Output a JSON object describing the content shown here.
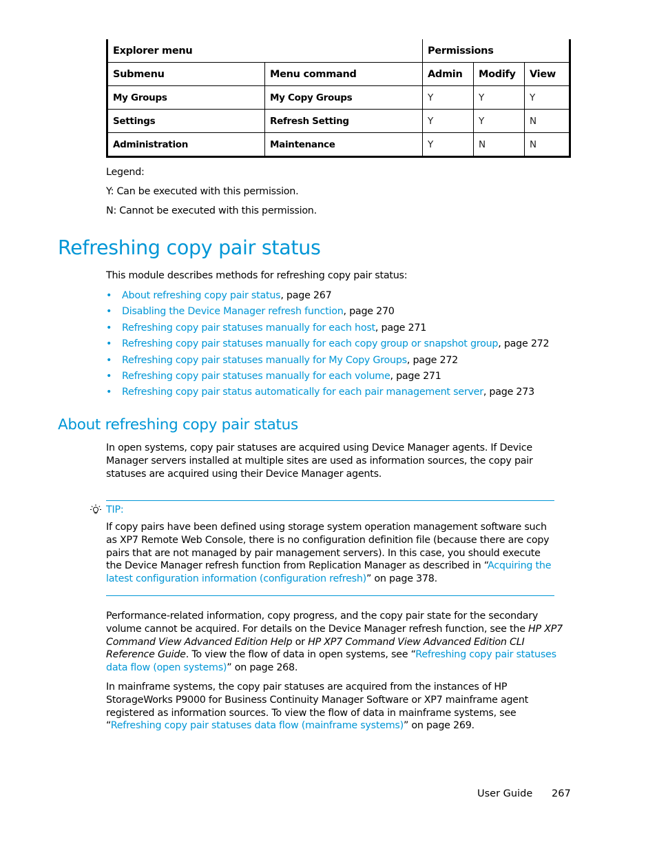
{
  "table": {
    "group_header": {
      "explorer_menu": "Explorer menu",
      "permissions": "Permissions"
    },
    "columns": [
      "Submenu",
      "Menu command",
      "Admin",
      "Modify",
      "View"
    ],
    "rows": [
      {
        "submenu": "My Groups",
        "command": "My Copy Groups",
        "admin": "Y",
        "modify": "Y",
        "view": "Y"
      },
      {
        "submenu": "Settings",
        "command": "Refresh Setting",
        "admin": "Y",
        "modify": "Y",
        "view": "N"
      },
      {
        "submenu": "Administration",
        "command": "Maintenance",
        "admin": "Y",
        "modify": "N",
        "view": "N"
      }
    ]
  },
  "legend": {
    "title": "Legend:",
    "y": "Y: Can be executed with this permission.",
    "n": "N: Cannot be executed with this permission."
  },
  "section": {
    "title": "Refreshing copy pair status",
    "intro": "This module describes methods for refreshing copy pair status:",
    "toc": [
      {
        "link": "About refreshing copy pair status",
        "page": ", page 267"
      },
      {
        "link": "Disabling the Device Manager refresh function",
        "page": ", page 270"
      },
      {
        "link": "Refreshing copy pair statuses manually for each host",
        "page": ", page 271"
      },
      {
        "link": "Refreshing copy pair statuses manually for each copy group or snapshot group",
        "page": ", page 272"
      },
      {
        "link": "Refreshing copy pair statuses manually for My Copy Groups",
        "page": ", page 272"
      },
      {
        "link": "Refreshing copy pair statuses manually for each volume",
        "page": ", page 271"
      },
      {
        "link": "Refreshing copy pair status automatically for each pair management server",
        "page": ", page 273"
      }
    ]
  },
  "subsection": {
    "title": "About refreshing copy pair status",
    "para1": "In open systems, copy pair statuses are acquired using Device Manager agents. If Device Manager servers installed at multiple sites are used as information sources, the copy pair statuses are acquired using their Device Manager agents.",
    "tip": {
      "label": "TIP:",
      "text_before": "If copy pairs have been defined using storage system operation management software such as XP7 Remote Web Console, there is no configuration definition file (because there are copy pairs that are not managed by pair management servers). In this case, you should execute the Device Manager refresh function from Replication Manager as described in “",
      "link": "Acquiring the latest configuration information (configuration refresh)",
      "text_after": "” on page 378."
    },
    "para2": {
      "text1": "Performance-related information, copy progress, and the copy pair state for the secondary volume cannot be acquired. For details on the Device Manager refresh function, see the ",
      "italic1": "HP XP7 Command View Advanced Edition Help",
      "text2": " or ",
      "italic2": "HP XP7 Command View Advanced Edition CLI Reference Guide",
      "text3": ".  To view the flow of data in open systems, see “",
      "link": "Refreshing copy pair statuses data flow (open systems)",
      "text4": "” on page 268."
    },
    "para3": {
      "text1": "In mainframe systems, the copy pair statuses are acquired from the instances of HP StorageWorks P9000 for Business Continuity Manager Software or XP7 mainframe agent registered as information sources. To view the flow of data in mainframe systems, see “",
      "link": "Refreshing copy pair statuses data flow (mainframe systems)",
      "text2": "” on page 269."
    }
  },
  "footer": {
    "label": "User Guide",
    "page_number": "267"
  },
  "colors": {
    "accent": "#0096d6",
    "text": "#000000"
  }
}
